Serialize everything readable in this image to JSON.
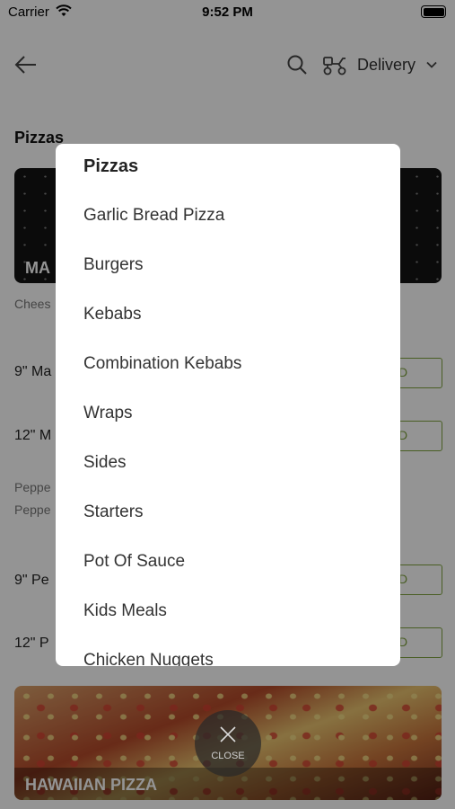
{
  "status_bar": {
    "carrier": "Carrier",
    "time": "9:52 PM"
  },
  "header": {
    "delivery_label": "Delivery"
  },
  "background": {
    "section_title": "Pizzas",
    "banner_title": "MA",
    "banner_desc": "Chees",
    "items": [
      "9\" Ma",
      "12\" M",
      "9\"  Pe",
      "12\" P"
    ],
    "add_label": "D",
    "pepper_desc_1": "Peppe",
    "pepper_desc_2": "Peppe",
    "banner2_title": "HAWAIIAN PIZZA"
  },
  "modal": {
    "title": "Pizzas",
    "categories": [
      "Garlic Bread Pizza",
      "Burgers",
      "Kebabs",
      "Combination Kebabs",
      "Wraps",
      "Sides",
      "Starters",
      "Pot Of Sauce",
      "Kids Meals",
      "Chicken Nuggets"
    ]
  },
  "close_button": {
    "label": "CLOSE"
  },
  "icons": {
    "back": "arrow-left-icon",
    "search": "search-icon",
    "delivery": "scooter-icon",
    "dropdown": "chevron-down-icon",
    "close": "close-icon",
    "wifi": "wifi-icon",
    "battery": "battery-icon"
  },
  "colors": {
    "accent": "#7fa33f"
  }
}
